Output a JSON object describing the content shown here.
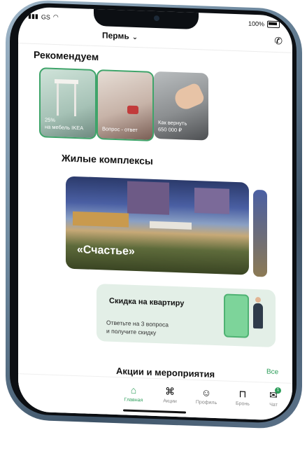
{
  "status_bar": {
    "carrier": "GS",
    "battery": "100%"
  },
  "header": {
    "city": "Пермь",
    "chevron_icon": "chevron-down-icon",
    "phone_icon": "phone-icon"
  },
  "recommend": {
    "title": "Рекомендуем",
    "cards": [
      {
        "caption_line1": "25%",
        "caption_line2": "на мебель IKEA"
      },
      {
        "caption_line1": "Вопрос - ответ",
        "caption_line2": ""
      },
      {
        "caption_line1": "Как вернуть",
        "caption_line2": "650 000 ₽"
      }
    ]
  },
  "complexes": {
    "title": "Жилые комплексы",
    "card_title": "«Счастье»"
  },
  "discount": {
    "title": "Скидка на квартиру",
    "line1": "Ответьте на 3 вопроса",
    "line2": "и получите скидку"
  },
  "promos": {
    "title": "Акции и мероприятия",
    "all_link": "Все"
  },
  "tabs": [
    {
      "label": "Главная",
      "icon": "home-icon",
      "active": true
    },
    {
      "label": "Акции",
      "icon": "tag-icon",
      "active": false
    },
    {
      "label": "Профиль",
      "icon": "profile-icon",
      "active": false
    },
    {
      "label": "Бронь",
      "icon": "lock-icon",
      "active": false
    },
    {
      "label": "Чат",
      "icon": "chat-icon",
      "active": false,
      "badge": "1"
    }
  ],
  "colors": {
    "accent": "#2e9e5b",
    "card_green": "#e3efe7"
  }
}
